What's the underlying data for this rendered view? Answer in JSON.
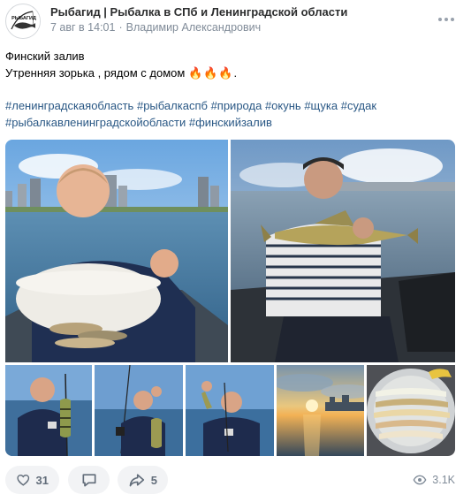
{
  "header": {
    "avatar_text": "РЫБАГИД",
    "group_name": "Рыбагид | Рыбалка в СПб и Ленинградской области",
    "date": "7 авг в 14:01",
    "author": "Владимир Александрович",
    "more_icon": "more-horizontal-icon"
  },
  "post": {
    "line1": "Финский залив",
    "line2": "Утренняя зорька , рядом с домом",
    "emoji": "🔥🔥🔥",
    "line2_end": ".",
    "hashtags_line1": [
      "#ленинградскаяобласть",
      "#рыбалкаспб",
      "#природа",
      "#окунь",
      "#щука",
      "#судак"
    ],
    "hashtags_line2": [
      "#рыбалкавленинградскойобласти",
      "#финскийзалив"
    ]
  },
  "footer": {
    "likes": "31",
    "shares": "5",
    "views": "3.1K",
    "like_icon": "heart-icon",
    "comment_icon": "comment-icon",
    "share_icon": "share-arrow-icon",
    "views_icon": "eye-icon"
  },
  "colors": {
    "link": "#2a5885",
    "secondary": "#818c99",
    "button_bg": "#f2f3f5",
    "icon": "#626d7a"
  }
}
